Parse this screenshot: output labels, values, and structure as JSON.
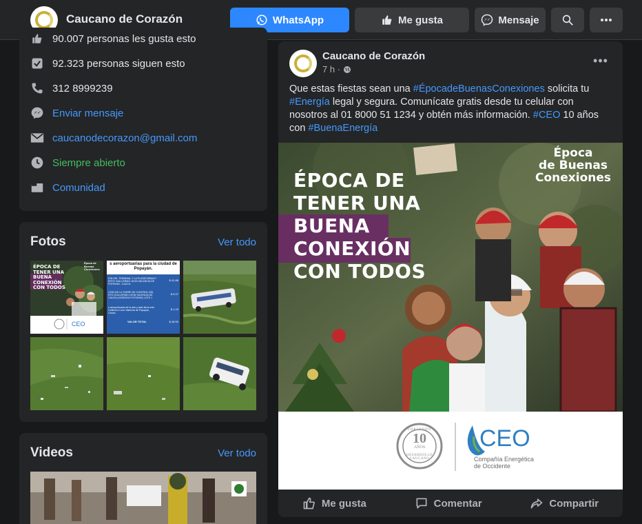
{
  "header": {
    "page_name": "Caucano de Corazón",
    "whatsapp_label": "WhatsApp",
    "like_label": "Me gusta",
    "message_label": "Mensaje"
  },
  "about": {
    "likes_partial": "90.007 personas les gusta esto",
    "followers": "92.323 personas siguen esto",
    "phone": "312 8999239",
    "send_message": "Enviar mensaje",
    "email": "caucanodecorazon@gmail.com",
    "hours": "Siempre abierto",
    "category": "Comunidad"
  },
  "photos": {
    "title": "Fotos",
    "see_all": "Ver todo",
    "thumb1": {
      "lines": [
        "ÉPOCA DE",
        "TENER UNA",
        "BUENA",
        "CONEXIÓN",
        "CON TODOS"
      ],
      "badge": "Época de Buenas Conexiones",
      "ceo": "CEO"
    },
    "thumb2": {
      "header": "s aeroportuarias para la ciudad de Popayán.",
      "rows": [
        {
          "desc": "ION DEL TERMINAL Y LA PLATAFORMA P. ERTO GUILLERMO LEON VALENCIA DE POPAYAN - CAUCA",
          "val": "$ 41.88"
        },
        {
          "desc": "CION DE LA TORRE DE CONTROL DEL RTO GUILLERMO LEON VALENCIA DE CAUCA (VIGENCIA FUTURAS) LOTE 1",
          "val": "$ 5.07"
        },
        {
          "desc": "n aeroportuaria de la aire y lado tierra erto Guillermo Leon Valencia de Popayán, Cauca.",
          "val": "$ 1.25"
        },
        {
          "desc": "VALOR TOTAL",
          "val": "$ 48.99"
        }
      ]
    }
  },
  "videos": {
    "title": "Videos",
    "see_all": "Ver todo"
  },
  "post": {
    "author": "Caucano de Corazón",
    "time": "7 h ·",
    "text": {
      "p1": "Que estas fiestas sean una ",
      "tag1": "#ÉpocadeBuenasConexiones",
      "p2": " solicita tu ",
      "tag2": "#Energía",
      "p3": " legal y segura. Comunícate gratis desde tu celular con nosotros al 01 8000 51 1234 y obtén más información. ",
      "tag3": "#CEO",
      "p4": " 10 años con ",
      "tag4": "#BuenaEnergía"
    },
    "image": {
      "line1": "ÉPOCA DE",
      "line2": "TENER UNA",
      "line3": "BUENA",
      "line4": "CONEXIÓN",
      "line5": "CON TODOS",
      "badge1": "Época",
      "badge2": "de Buenas",
      "badge3": "Conexiones",
      "seal_top": "FORJANDO",
      "seal_number": "10",
      "seal_years": "AÑOS",
      "seal_bottom": "DESARROLLO CAUCANO",
      "ceo": "CEO",
      "ceo_sub1": "Compañía Energética",
      "ceo_sub2": "de Occidente"
    },
    "actions": {
      "like": "Me gusta",
      "comment": "Comentar",
      "share": "Compartir"
    }
  },
  "colors": {
    "bg": "#18191a",
    "card": "#242526",
    "accent": "#2d88ff",
    "link": "#4599ff",
    "green": "#45bd62",
    "promo_purple": "#6b2a66"
  }
}
